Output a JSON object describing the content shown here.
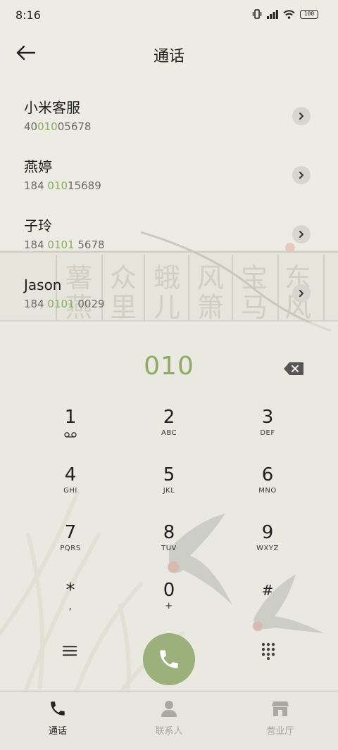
{
  "status_bar": {
    "time": "8:16",
    "battery": "100"
  },
  "header": {
    "title": "通话"
  },
  "contacts": [
    {
      "name": "小米客服",
      "number_parts": [
        "40",
        "010",
        "05678"
      ]
    },
    {
      "name": "燕婷",
      "number_parts": [
        "184 ",
        "010",
        "15689"
      ]
    },
    {
      "name": "子玲",
      "number_parts": [
        "184 ",
        "0101",
        " 5678"
      ]
    },
    {
      "name": "Jason",
      "number_parts": [
        "184 ",
        "0101",
        " 0029"
      ]
    }
  ],
  "dialer": {
    "entered_number": "010"
  },
  "keypad": [
    {
      "digit": "1",
      "letters": ""
    },
    {
      "digit": "2",
      "letters": "ABC"
    },
    {
      "digit": "3",
      "letters": "DEF"
    },
    {
      "digit": "4",
      "letters": "GHI"
    },
    {
      "digit": "5",
      "letters": "JKL"
    },
    {
      "digit": "6",
      "letters": "MNO"
    },
    {
      "digit": "7",
      "letters": "PQRS"
    },
    {
      "digit": "8",
      "letters": "TUV"
    },
    {
      "digit": "9",
      "letters": "WXYZ"
    },
    {
      "digit": "*",
      "letters": ","
    },
    {
      "digit": "0",
      "letters": "+"
    },
    {
      "digit": "#",
      "letters": ""
    }
  ],
  "background_art": {
    "calligraphy": [
      "薯",
      "众",
      "蛾",
      "风",
      "宝",
      "东",
      "燕",
      "里",
      "儿",
      "箫",
      "马",
      "风"
    ]
  },
  "bottom_nav": [
    {
      "label": "通话",
      "active": true
    },
    {
      "label": "联系人",
      "active": false
    },
    {
      "label": "营业厅",
      "active": false
    }
  ],
  "colors": {
    "highlight": "#8bab5f",
    "call_button": "#9bb07a",
    "background": "#ecece4"
  }
}
